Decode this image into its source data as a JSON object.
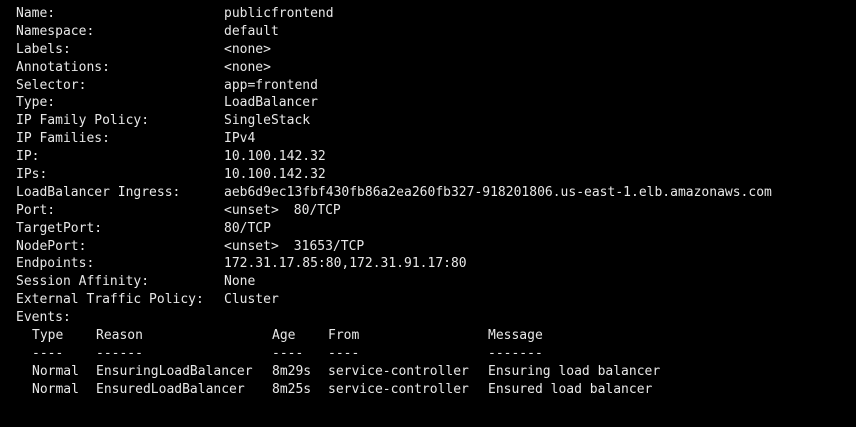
{
  "service": {
    "name": {
      "key": "Name:",
      "value": "publicfrontend"
    },
    "namespace": {
      "key": "Namespace:",
      "value": "default"
    },
    "labels": {
      "key": "Labels:",
      "value": "<none>"
    },
    "annotations": {
      "key": "Annotations:",
      "value": "<none>"
    },
    "selector": {
      "key": "Selector:",
      "value": "app=frontend"
    },
    "type": {
      "key": "Type:",
      "value": "LoadBalancer"
    },
    "ip_family_policy": {
      "key": "IP Family Policy:",
      "value": "SingleStack"
    },
    "ip_families": {
      "key": "IP Families:",
      "value": "IPv4"
    },
    "ip": {
      "key": "IP:",
      "value": "10.100.142.32"
    },
    "ips": {
      "key": "IPs:",
      "value": "10.100.142.32"
    },
    "lb_ingress": {
      "key": "LoadBalancer Ingress:",
      "value": "aeb6d9ec13fbf430fb86a2ea260fb327-918201806.us-east-1.elb.amazonaws.com"
    },
    "port": {
      "key": "Port:",
      "name": "<unset>",
      "value": "80/TCP"
    },
    "target_port": {
      "key": "TargetPort:",
      "value": "80/TCP"
    },
    "node_port": {
      "key": "NodePort:",
      "name": "<unset>",
      "value": "31653/TCP"
    },
    "endpoints": {
      "key": "Endpoints:",
      "value": "172.31.17.85:80,172.31.91.17:80"
    },
    "session_affinity": {
      "key": "Session Affinity:",
      "value": "None"
    },
    "external_traffic_policy": {
      "key": "External Traffic Policy:",
      "value": "Cluster"
    }
  },
  "events": {
    "label": "Events:",
    "headers": {
      "type": "Type",
      "reason": "Reason",
      "age": "Age",
      "from": "From",
      "message": "Message"
    },
    "separators": {
      "type": "----",
      "reason": "------",
      "age": "----",
      "from": "----",
      "message": "-------"
    },
    "rows": [
      {
        "type": "Normal",
        "reason": "EnsuringLoadBalancer",
        "age": "8m29s",
        "from": "service-controller",
        "message": "Ensuring load balancer"
      },
      {
        "type": "Normal",
        "reason": "EnsuredLoadBalancer",
        "age": "8m25s",
        "from": "service-controller",
        "message": "Ensured load balancer"
      }
    ]
  }
}
